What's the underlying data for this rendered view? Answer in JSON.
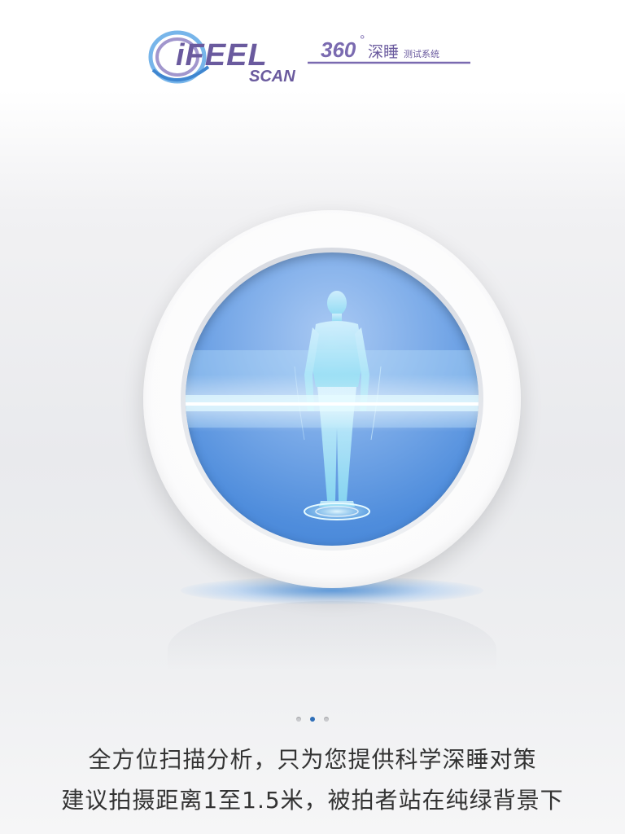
{
  "logo": {
    "brand": "iFEEL",
    "subbrand": "SCAN",
    "badge_number": "360",
    "badge_degree": "°",
    "badge_title": "深睡",
    "badge_subtitle": "测试系统"
  },
  "hero": {
    "illustration": "human-body-scan-icon"
  },
  "pager": {
    "total": 3,
    "current": 2
  },
  "caption": {
    "line1": "全方位扫描分析，只为您提供科学深睡对策",
    "line2": "建议拍摄距离1至1.5米，被拍者站在纯绿背景下"
  },
  "colors": {
    "brand_purple": "#6a5a9e",
    "scan_blue": "#4f8ddc",
    "active_dot": "#2f6fb8",
    "text": "#333333"
  }
}
